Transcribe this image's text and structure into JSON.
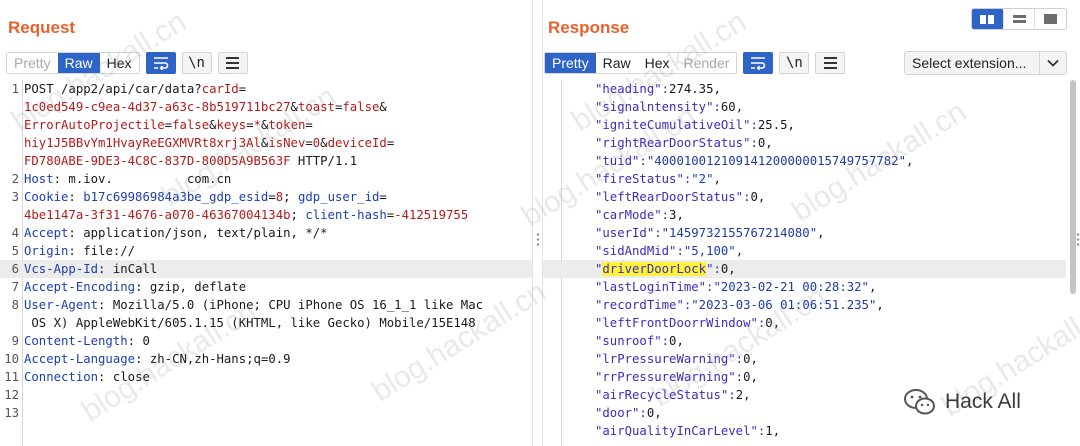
{
  "request": {
    "title": "Request",
    "tabs": [
      {
        "label": "Pretty",
        "state": "disabled"
      },
      {
        "label": "Raw",
        "state": "active"
      },
      {
        "label": "Hex",
        "state": "normal"
      }
    ],
    "newline_label": "\\n",
    "lines": [
      {
        "n": "1",
        "segs": [
          {
            "t": "POST /app2/api/car/data?",
            "c": "plain"
          },
          {
            "t": "carId",
            "c": "red"
          },
          {
            "t": "=",
            "c": "plain"
          }
        ]
      },
      {
        "n": "",
        "segs": [
          {
            "t": "1c0ed549-c9ea-4d37-a63c-8b519711bc27",
            "c": "red"
          },
          {
            "t": "&",
            "c": "plain"
          },
          {
            "t": "toast",
            "c": "red"
          },
          {
            "t": "=",
            "c": "plain"
          },
          {
            "t": "false",
            "c": "red"
          },
          {
            "t": "&",
            "c": "plain"
          }
        ]
      },
      {
        "n": "",
        "segs": [
          {
            "t": "ErrorAutoProjectile",
            "c": "red"
          },
          {
            "t": "=",
            "c": "plain"
          },
          {
            "t": "false",
            "c": "red"
          },
          {
            "t": "&",
            "c": "plain"
          },
          {
            "t": "keys",
            "c": "red"
          },
          {
            "t": "=",
            "c": "plain"
          },
          {
            "t": "*",
            "c": "red"
          },
          {
            "t": "&",
            "c": "plain"
          },
          {
            "t": "token",
            "c": "red"
          },
          {
            "t": "=",
            "c": "plain"
          }
        ]
      },
      {
        "n": "",
        "segs": [
          {
            "t": "hiy1J5BBvYm1HvayReEGXMVRt8xrj3Al",
            "c": "red"
          },
          {
            "t": "&",
            "c": "plain"
          },
          {
            "t": "isNev",
            "c": "red"
          },
          {
            "t": "=",
            "c": "plain"
          },
          {
            "t": "0",
            "c": "red"
          },
          {
            "t": "&",
            "c": "plain"
          },
          {
            "t": "deviceId",
            "c": "red"
          },
          {
            "t": "=",
            "c": "plain"
          }
        ]
      },
      {
        "n": "",
        "segs": [
          {
            "t": "FD780ABE-9DE3-4C8C-837D-800D5A9B563F",
            "c": "red"
          },
          {
            "t": " HTTP/1.1",
            "c": "plain"
          }
        ]
      },
      {
        "n": "2",
        "segs": [
          {
            "t": "Host",
            "c": "blue"
          },
          {
            "t": ": m.iov.          com.cn",
            "c": "plain"
          }
        ]
      },
      {
        "n": "3",
        "segs": [
          {
            "t": "Cookie",
            "c": "blue"
          },
          {
            "t": ": ",
            "c": "plain"
          },
          {
            "t": "b17c69986984a3be_gdp_esid",
            "c": "blue"
          },
          {
            "t": "=",
            "c": "plain"
          },
          {
            "t": "8",
            "c": "red"
          },
          {
            "t": "; ",
            "c": "plain"
          },
          {
            "t": "gdp_user_id",
            "c": "blue"
          },
          {
            "t": "=",
            "c": "plain"
          }
        ]
      },
      {
        "n": "",
        "segs": [
          {
            "t": "4be1147a-3f31-4676-a070-46367004134b",
            "c": "red"
          },
          {
            "t": "; ",
            "c": "plain"
          },
          {
            "t": "client-hash",
            "c": "blue"
          },
          {
            "t": "=",
            "c": "plain"
          },
          {
            "t": "-412519755",
            "c": "red"
          }
        ]
      },
      {
        "n": "4",
        "segs": [
          {
            "t": "Accept",
            "c": "blue"
          },
          {
            "t": ": application/json, text/plain, */*",
            "c": "plain"
          }
        ]
      },
      {
        "n": "5",
        "segs": [
          {
            "t": "Origin",
            "c": "blue"
          },
          {
            "t": ": file://",
            "c": "plain"
          }
        ]
      },
      {
        "n": "6",
        "hl": true,
        "segs": [
          {
            "t": "Vcs-App-Id",
            "c": "blue"
          },
          {
            "t": ": inCall",
            "c": "plain"
          }
        ]
      },
      {
        "n": "7",
        "segs": [
          {
            "t": "Accept-Encoding",
            "c": "blue"
          },
          {
            "t": ": gzip, deflate",
            "c": "plain"
          }
        ]
      },
      {
        "n": "8",
        "segs": [
          {
            "t": "User-Agent",
            "c": "blue"
          },
          {
            "t": ": Mozilla/5.0 (iPhone; CPU iPhone OS 16_1_1 like Mac",
            "c": "plain"
          }
        ]
      },
      {
        "n": "",
        "segs": [
          {
            "t": " OS X) AppleWebKit/605.1.15 (KHTML, like Gecko) Mobile/15E148",
            "c": "plain"
          }
        ]
      },
      {
        "n": "9",
        "segs": [
          {
            "t": "Content-Length",
            "c": "blue"
          },
          {
            "t": ": 0",
            "c": "plain"
          }
        ]
      },
      {
        "n": "10",
        "segs": [
          {
            "t": "Accept-Language",
            "c": "blue"
          },
          {
            "t": ": zh-CN,zh-Hans;q=0.9",
            "c": "plain"
          }
        ]
      },
      {
        "n": "11",
        "segs": [
          {
            "t": "Connection",
            "c": "blue"
          },
          {
            "t": ": close",
            "c": "plain"
          }
        ]
      },
      {
        "n": "12",
        "segs": []
      },
      {
        "n": "13",
        "segs": []
      }
    ]
  },
  "response": {
    "title": "Response",
    "tabs": [
      {
        "label": "Pretty",
        "state": "active"
      },
      {
        "label": "Raw",
        "state": "normal"
      },
      {
        "label": "Hex",
        "state": "normal"
      },
      {
        "label": "Render",
        "state": "disabled"
      }
    ],
    "newline_label": "\\n",
    "extension_select": "Select extension...",
    "lines": [
      {
        "k": "heading",
        "v": "274.35",
        "type": "num"
      },
      {
        "k": "signalntensity",
        "v": "60",
        "type": "num"
      },
      {
        "k": "igniteCumulativeOil",
        "v": "25.5",
        "type": "num"
      },
      {
        "k": "rightRearDoorStatus",
        "v": "0",
        "type": "num"
      },
      {
        "k": "tuid",
        "v": "400010012109141200000015749757782",
        "type": "str"
      },
      {
        "k": "fireStatus",
        "v": "2",
        "type": "str"
      },
      {
        "k": "leftRearDoorStatus",
        "v": "0",
        "type": "num"
      },
      {
        "k": "carMode",
        "v": "3",
        "type": "num"
      },
      {
        "k": "userId",
        "v": "1459732155767214080",
        "type": "str"
      },
      {
        "k": "sidAndMid",
        "v": "5,100",
        "type": "str"
      },
      {
        "k": "driverDoorLock",
        "v": "0",
        "type": "num",
        "hl": true,
        "match": true
      },
      {
        "k": "lastLoginTime",
        "v": "2023-02-21 00:28:32",
        "type": "str"
      },
      {
        "k": "recordTime",
        "v": "2023-03-06 01:06:51.235",
        "type": "str"
      },
      {
        "k": "leftFrontDoorrWindow",
        "v": "0",
        "type": "num"
      },
      {
        "k": "sunroof",
        "v": "0",
        "type": "num"
      },
      {
        "k": "lrPressureWarning",
        "v": "0",
        "type": "num"
      },
      {
        "k": "rrPressureWarning",
        "v": "0",
        "type": "num"
      },
      {
        "k": "airRecycleStatus",
        "v": "2",
        "type": "num"
      },
      {
        "k": "door",
        "v": "0",
        "type": "num"
      },
      {
        "k": "airQualityInCarLevel",
        "v": "1",
        "type": "num"
      }
    ]
  },
  "watermark_text": "blog.hackall.cn",
  "brand_label": "Hack All",
  "colors": {
    "accent": "#2e63c8",
    "title": "#e8622c",
    "highlight_match": "#fff23a"
  }
}
